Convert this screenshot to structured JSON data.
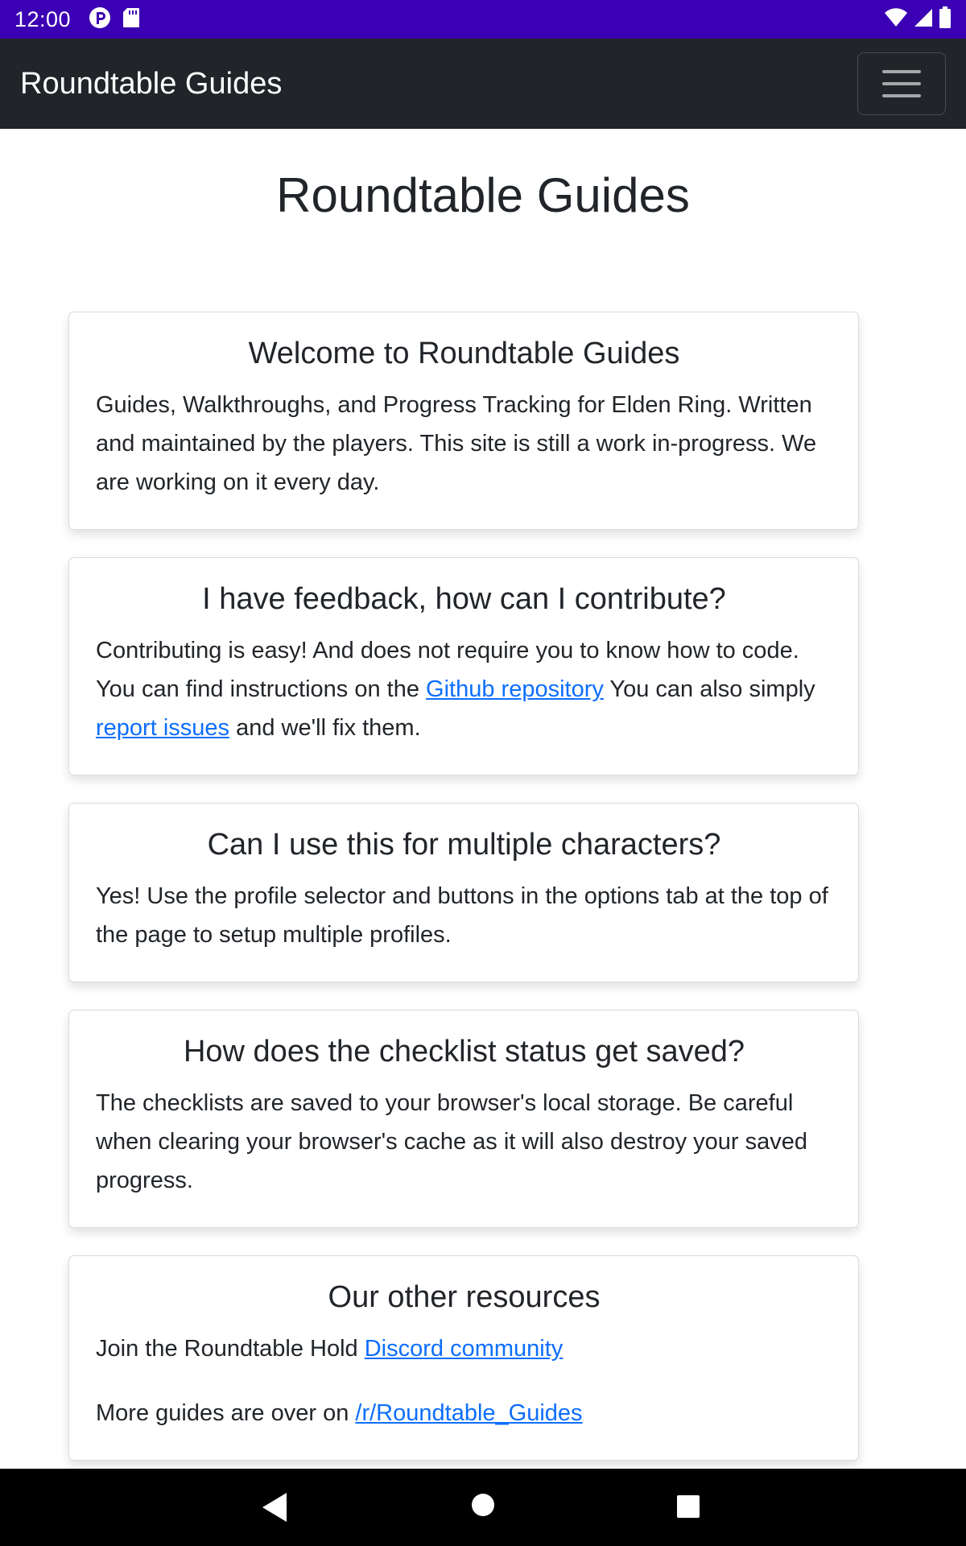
{
  "status_bar": {
    "time": "12:00",
    "left_icons": [
      "notification-p-icon",
      "sd-card-icon"
    ],
    "right_icons": [
      "wifi-icon",
      "signal-icon",
      "battery-icon"
    ]
  },
  "navbar": {
    "brand": "Roundtable Guides",
    "toggler_icon": "hamburger-menu-icon"
  },
  "page": {
    "title": "Roundtable Guides"
  },
  "cards": [
    {
      "title": "Welcome to Roundtable Guides",
      "text": "Guides, Walkthroughs, and Progress Tracking for Elden Ring. Written and maintained by the players. This site is still a work in-progress. We are working on it every day."
    },
    {
      "title": "I have feedback, how can I contribute?",
      "text_1": "Contributing is easy! And does not require you to know how to code. You can find instructions on the ",
      "link_1": "Github repository",
      "text_2": " You can also simply ",
      "link_2": "report issues",
      "text_3": " and we'll fix them."
    },
    {
      "title": "Can I use this for multiple characters?",
      "text": "Yes! Use the profile selector and buttons in the options tab at the top of the page to setup multiple profiles."
    },
    {
      "title": "How does the checklist status get saved?",
      "text": "The checklists are saved to your browser's local storage. Be careful when clearing your browser's cache as it will also destroy your saved progress."
    },
    {
      "title": "Our other resources",
      "line1_text": "Join the Roundtable Hold ",
      "line1_link": "Discord community",
      "line2_text": "More guides are over on ",
      "line2_link": "/r/Roundtable_Guides"
    }
  ],
  "system_nav": {
    "icons": [
      "back-icon",
      "home-icon",
      "recents-icon"
    ]
  },
  "colors": {
    "status_bar": "#3b00b3",
    "navbar": "#212529",
    "link": "#0d6efd"
  }
}
